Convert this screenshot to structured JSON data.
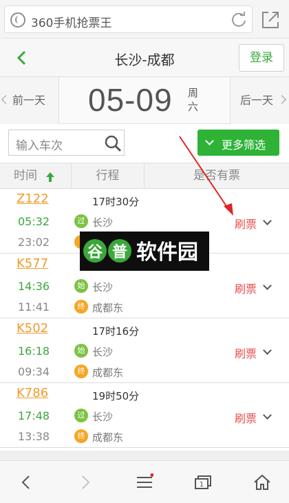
{
  "browser": {
    "address_text": "360手机抢票王",
    "icons": [
      "globe-icon",
      "refresh-icon",
      "share-icon"
    ]
  },
  "header": {
    "title": "长沙-成都",
    "login_label": "登录",
    "back_icon": "chevron-left-icon"
  },
  "date_bar": {
    "prev_label": "前一天",
    "date": "05-09",
    "weekday_zhou": "周",
    "weekday_day": "六",
    "next_label": "后一天"
  },
  "filters": {
    "train_placeholder": "输入车次",
    "more_filters_label": "更多筛选"
  },
  "columns": {
    "time": "时间",
    "route": "行程",
    "availability": "是否有票"
  },
  "trains": [
    {
      "number": "Z122",
      "duration": "17时30分",
      "depart_time": "05:32",
      "arrive_time": "23:02",
      "depart_badge": "过",
      "arrive_badge": "",
      "depart_station": "长沙",
      "arrive_station": "",
      "action": "刷票"
    },
    {
      "number": "K577",
      "duration": "",
      "depart_time": "14:36",
      "arrive_time": "11:41",
      "depart_badge": "始",
      "arrive_badge": "终",
      "depart_station": "长沙",
      "arrive_station": "成都东",
      "action": "刷票"
    },
    {
      "number": "K502",
      "duration": "17时16分",
      "depart_time": "16:18",
      "arrive_time": "09:34",
      "depart_badge": "始",
      "arrive_badge": "终",
      "depart_station": "长沙",
      "arrive_station": "成都东",
      "action": "刷票"
    },
    {
      "number": "K786",
      "duration": "19时50分",
      "depart_time": "17:48",
      "arrive_time": "13:38",
      "depart_badge": "过",
      "arrive_badge": "终",
      "depart_station": "长沙",
      "arrive_station": "成都东",
      "action": "刷票"
    }
  ],
  "watermark": {
    "text": "谷普软件园"
  },
  "colors": {
    "accent_green": "#2fb337",
    "train_orange": "#f39a2a",
    "refresh_red": "#e84c4c",
    "badge_pass": "#7dc243",
    "badge_end": "#f5a623"
  }
}
